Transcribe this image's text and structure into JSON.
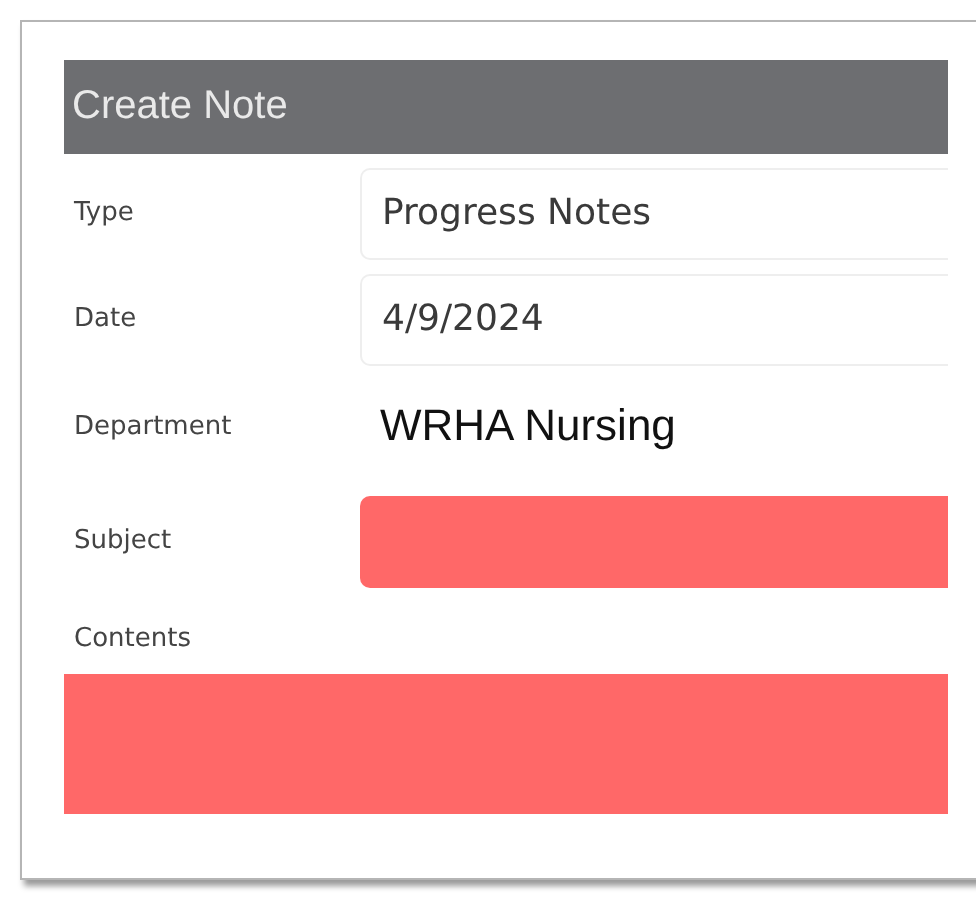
{
  "form": {
    "title": "Create Note",
    "fields": [
      {
        "label": "Type",
        "kind": "line",
        "value": "Progress Notes",
        "invalid": false
      },
      {
        "label": "Date",
        "kind": "line",
        "value": "4/9/2024",
        "invalid": false
      },
      {
        "label": "Department",
        "kind": "plain",
        "value": "WRHA Nursing"
      },
      {
        "label": "Subject",
        "kind": "line",
        "invalid": true
      },
      {
        "label": "Contents",
        "kind": "block",
        "invalid": true
      }
    ]
  }
}
